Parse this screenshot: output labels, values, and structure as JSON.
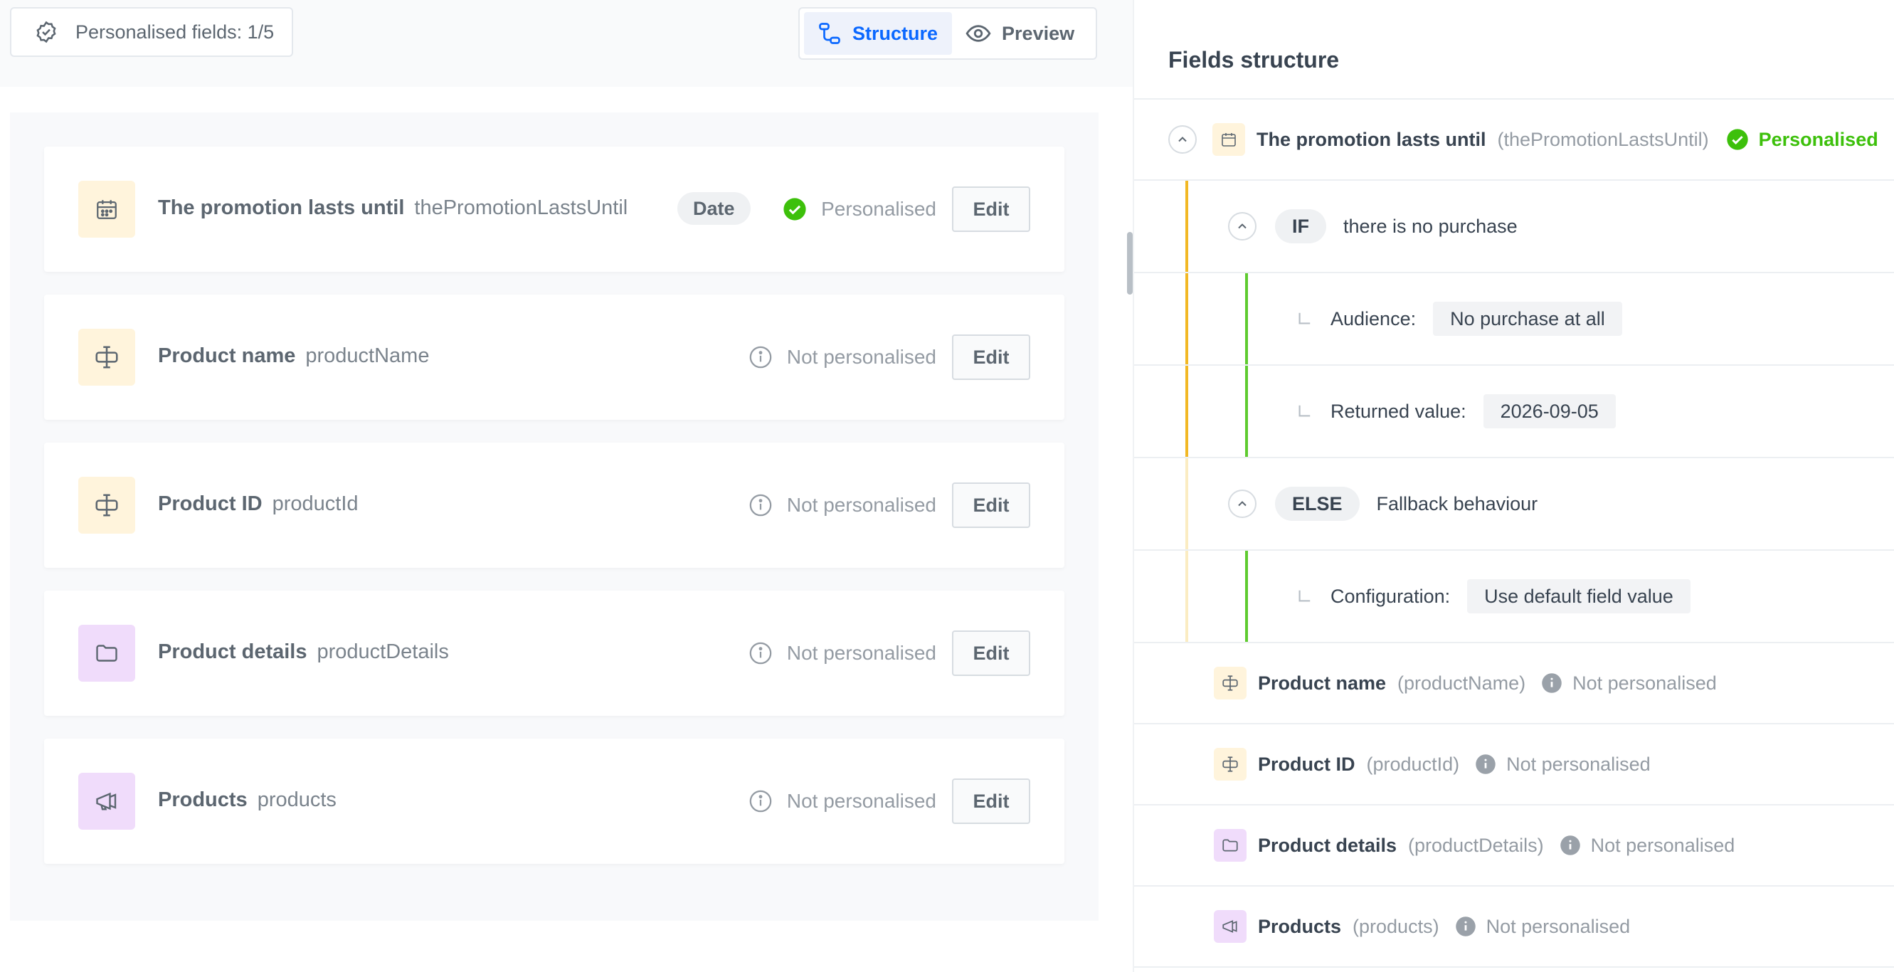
{
  "toolbar": {
    "personalised_fields": "Personalised fields: 1/5",
    "view_structure": "Structure",
    "view_preview": "Preview"
  },
  "fields": [
    {
      "title": "The promotion lasts until",
      "key": "thePromotionLastsUntil",
      "type": "Date",
      "status": "Personalised",
      "edit": "Edit",
      "icon": "calendar-icon"
    },
    {
      "title": "Product name",
      "key": "productName",
      "status": "Not personalised",
      "edit": "Edit",
      "icon": "text-field-icon"
    },
    {
      "title": "Product ID",
      "key": "productId",
      "status": "Not personalised",
      "edit": "Edit",
      "icon": "text-field-icon"
    },
    {
      "title": "Product details",
      "key": "productDetails",
      "status": "Not personalised",
      "edit": "Edit",
      "icon": "folder-icon"
    },
    {
      "title": "Products",
      "key": "products",
      "status": "Not personalised",
      "edit": "Edit",
      "icon": "megaphone-icon"
    }
  ],
  "structure": {
    "title": "Fields structure",
    "root": {
      "title": "The promotion lasts until",
      "key": "(thePromotionLastsUntil)",
      "status": "Personalised"
    },
    "if_branch": {
      "keyword": "IF",
      "condition": "there is no purchase",
      "audience_label": "Audience:",
      "audience_value": "No purchase at all",
      "returned_label": "Returned value:",
      "returned_value": "2026-09-05"
    },
    "else_branch": {
      "keyword": "ELSE",
      "condition": "Fallback behaviour",
      "config_label": "Configuration:",
      "config_value": "Use default field value"
    },
    "others": [
      {
        "title": "Product name",
        "key": "(productName)",
        "status": "Not personalised"
      },
      {
        "title": "Product ID",
        "key": "(productId)",
        "status": "Not personalised"
      },
      {
        "title": "Product details",
        "key": "(productDetails)",
        "status": "Not personalised"
      },
      {
        "title": "Products",
        "key": "(products)",
        "status": "Not personalised"
      }
    ]
  },
  "colors": {
    "accent": "#0b68ff",
    "success": "#3dc00b",
    "if_bar": "#f2b824",
    "branch_bar": "#5ecb2f"
  }
}
